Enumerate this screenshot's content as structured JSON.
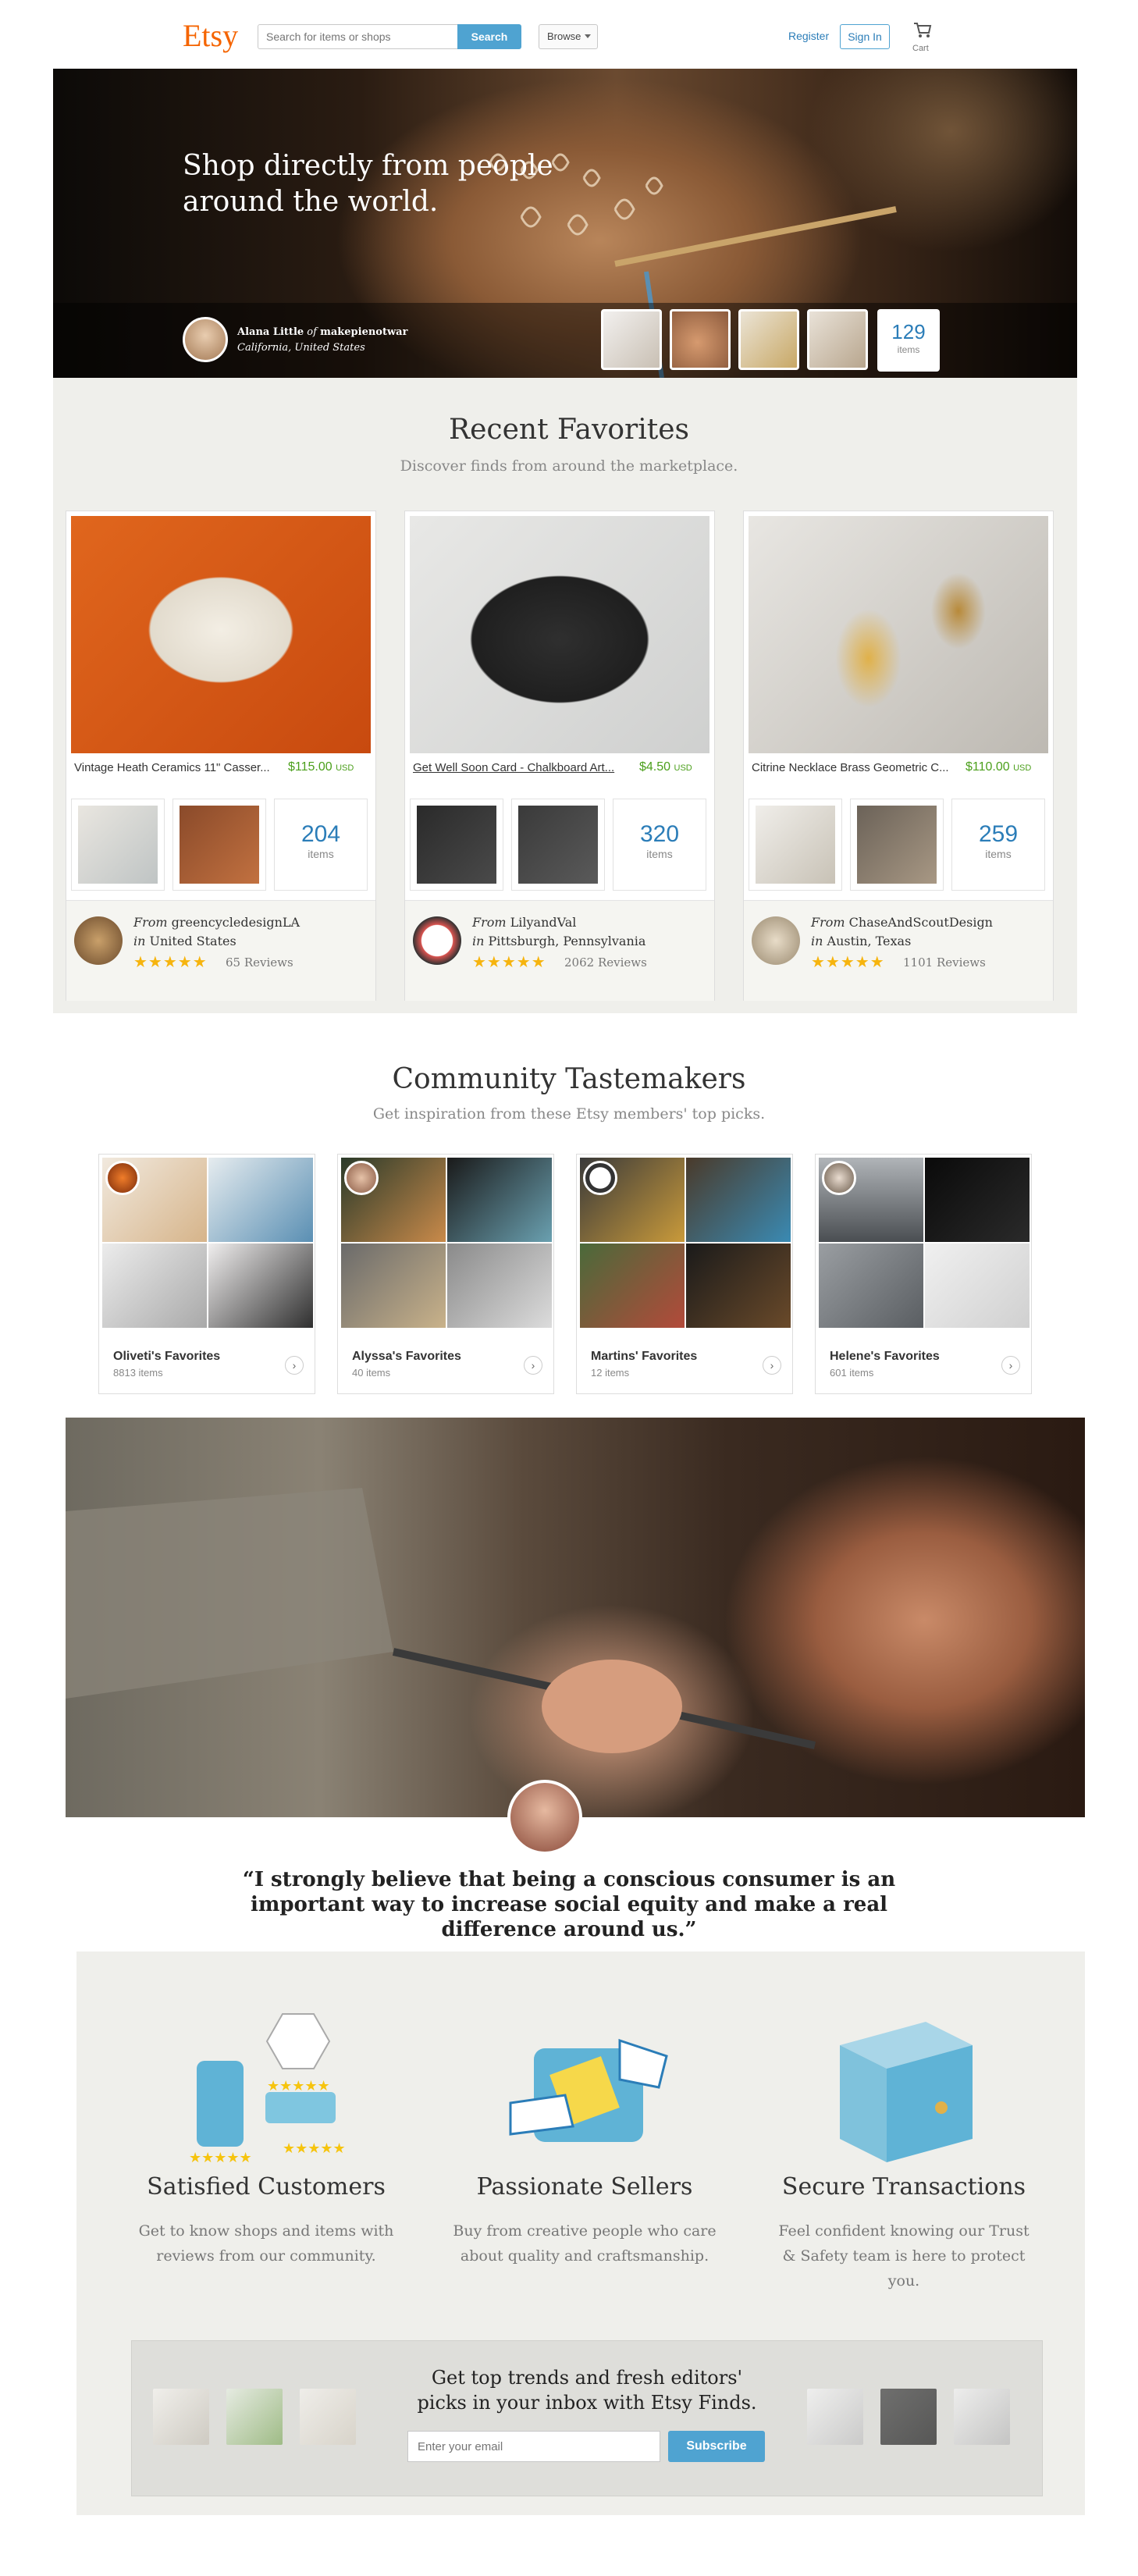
{
  "header": {
    "logo": "Etsy",
    "search_placeholder": "Search for items or shops",
    "search_button": "Search",
    "browse": "Browse",
    "register": "Register",
    "sign_in": "Sign In",
    "cart": "Cart"
  },
  "hero": {
    "headline": "Shop directly from people around the world.",
    "seller_name": "Alana Little",
    "seller_of": "of",
    "seller_shop": "makepienotwar",
    "seller_location": "California, United States",
    "items_count": "129",
    "items_label": "items"
  },
  "recent_favorites": {
    "title": "Recent Favorites",
    "subtitle": "Discover finds from around the marketplace.",
    "cards": [
      {
        "item_title": "Vintage Heath Ceramics 11\" Casser...",
        "price": "$115.00",
        "currency": "USD",
        "items_count": "204",
        "items_label": "items",
        "from_label": "From",
        "shop": "greencycledesignLA",
        "in_label": "in",
        "location": "United States",
        "stars": "★★★★★",
        "reviews": "65 Reviews"
      },
      {
        "item_title": "Get Well Soon Card - Chalkboard Art...",
        "price": "$4.50",
        "currency": "USD",
        "items_count": "320",
        "items_label": "items",
        "from_label": "From",
        "shop": "LilyandVal",
        "in_label": "in",
        "location": "Pittsburgh, Pennsylvania",
        "stars": "★★★★★",
        "reviews": "2062 Reviews"
      },
      {
        "item_title": "Citrine Necklace Brass Geometric C...",
        "price": "$110.00",
        "currency": "USD",
        "items_count": "259",
        "items_label": "items",
        "from_label": "From",
        "shop": "ChaseAndScoutDesign",
        "in_label": "in",
        "location": "Austin, Texas",
        "stars": "★★★★★",
        "reviews": "1101 Reviews"
      }
    ]
  },
  "tastemakers": {
    "title": "Community Tastemakers",
    "subtitle": "Get inspiration from these Etsy members' top picks.",
    "cards": [
      {
        "name": "Oliveti's Favorites",
        "count": "8813 items"
      },
      {
        "name": "Alyssa's Favorites",
        "count": "40 items"
      },
      {
        "name": "Martins' Favorites",
        "count": "12 items"
      },
      {
        "name": "Helene's Favorites",
        "count": "601 items"
      }
    ]
  },
  "story": {
    "quote": "“I strongly believe that being a conscious consumer is an important way to increase social equity and make a real difference around us.”"
  },
  "value_props": [
    {
      "title": "Satisfied Customers",
      "desc": "Get to know shops and items with reviews from our community."
    },
    {
      "title": "Passionate Sellers",
      "desc": "Buy from creative people who care about quality and craftsmanship."
    },
    {
      "title": "Secure Transactions",
      "desc": "Feel confident knowing our Trust & Safety team is here to protect you."
    }
  ],
  "newsletter": {
    "title": "Get top trends and fresh editors' picks in your inbox with Etsy Finds.",
    "email_placeholder": "Enter your email",
    "subscribe": "Subscribe"
  },
  "icons": {
    "cart": "cart-icon",
    "browse_caret": "chevron-down-icon",
    "card_arrow": "chevron-right-icon",
    "stars": "star-icon"
  },
  "colors": {
    "brand": "#f56400",
    "link": "#2b7db8",
    "button": "#4fa3d1",
    "price": "#4b9f1b",
    "star": "#f6b40e",
    "section_bg": "#efefeb"
  }
}
